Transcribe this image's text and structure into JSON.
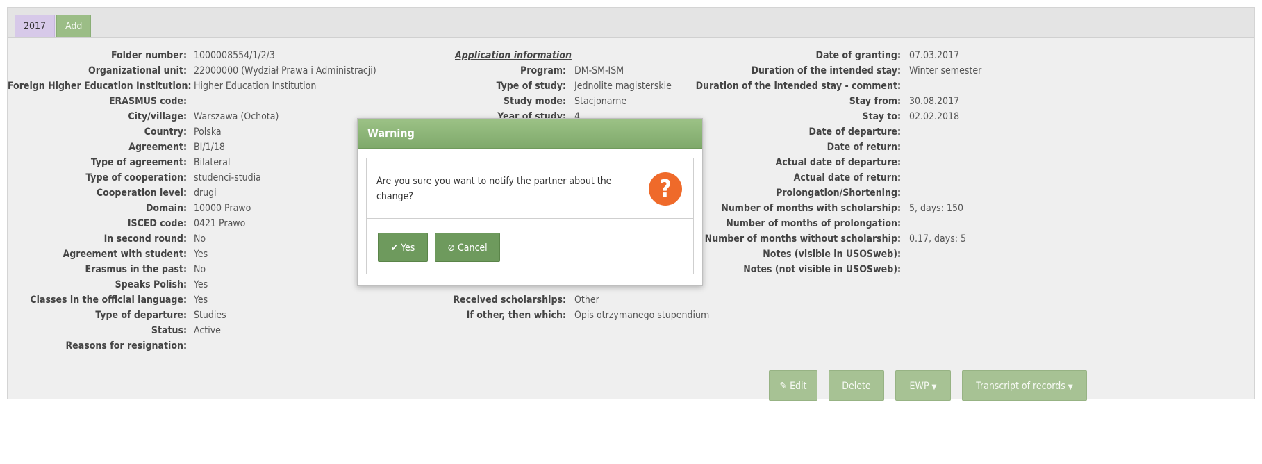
{
  "tabs": [
    {
      "label": "2017"
    },
    {
      "label": "Add"
    }
  ],
  "left_col": [
    {
      "label": "Folder number:",
      "value": "1000008554/1/2/3"
    },
    {
      "label": "Organizational unit:",
      "value": "22000000 (Wydział Prawa i Administracji)"
    },
    {
      "label": "Foreign Higher Education Institution:",
      "value": "Higher Education Institution"
    },
    {
      "label": "ERASMUS code:",
      "value": ""
    },
    {
      "label": "City/village:",
      "value": "Warszawa (Ochota)"
    },
    {
      "label": "Country:",
      "value": "Polska"
    },
    {
      "label": "Agreement:",
      "value": "BI/1/18"
    },
    {
      "label": "Type of agreement:",
      "value": "Bilateral"
    },
    {
      "label": "Type of cooperation:",
      "value": "studenci-studia"
    },
    {
      "label": "Cooperation level:",
      "value": "drugi"
    },
    {
      "label": "Domain:",
      "value": "10000 Prawo"
    },
    {
      "label": "ISCED code:",
      "value": "0421 Prawo"
    },
    {
      "label": "In second round:",
      "value": "No"
    },
    {
      "label": "Agreement with student:",
      "value": "Yes"
    },
    {
      "label": "Erasmus in the past:",
      "value": "No"
    },
    {
      "label": "Speaks Polish:",
      "value": "Yes"
    },
    {
      "label": "Classes in the official language:",
      "value": "Yes"
    },
    {
      "label": "Type of departure:",
      "value": "Studies"
    },
    {
      "label": "Status:",
      "value": "Active"
    },
    {
      "label": "Reasons for resignation:",
      "value": ""
    }
  ],
  "middle": {
    "section_title": "Application information",
    "rows": [
      {
        "label": "Program:",
        "value": "DM-SM-ISM"
      },
      {
        "label": "Type of study:",
        "value": "Jednolite magisterskie"
      },
      {
        "label": "Study mode:",
        "value": "Stacjonarne"
      },
      {
        "label": "Year of study:",
        "value": "4"
      },
      {
        "label": "Received scholarships:",
        "value": "Other"
      },
      {
        "label": "If other, then which:",
        "value": "Opis otrzymanego stupendium"
      }
    ]
  },
  "right_col": [
    {
      "label": "Date of granting:",
      "value": "07.03.2017"
    },
    {
      "label": "Duration of the intended stay:",
      "value": "Winter semester"
    },
    {
      "label": "Duration of the intended stay - comment:",
      "value": ""
    },
    {
      "label": "Stay from:",
      "value": "30.08.2017"
    },
    {
      "label": "Stay to:",
      "value": "02.02.2018"
    },
    {
      "label": "Date of departure:",
      "value": ""
    },
    {
      "label": "Date of return:",
      "value": ""
    },
    {
      "label": "Actual date of departure:",
      "value": ""
    },
    {
      "label": "Actual date of return:",
      "value": ""
    },
    {
      "label": "Prolongation/Shortening:",
      "value": ""
    },
    {
      "label": "Number of months with scholarship:",
      "value": "5, days: 150"
    },
    {
      "label": "Number of months of prolongation:",
      "value": ""
    },
    {
      "label": "Number of months without scholarship:",
      "value": "0.17, days: 5"
    },
    {
      "label": "Notes (visible in USOSweb):",
      "value": ""
    },
    {
      "label": "Notes (not visible in USOSweb):",
      "value": ""
    }
  ],
  "actions": {
    "edit": "Edit",
    "delete": "Delete",
    "ewp": "EWP",
    "transcript": "Transcript of records"
  },
  "dialog": {
    "title": "Warning",
    "message": "Are you sure you want to notify the partner about the change?",
    "yes": "Yes",
    "cancel": "Cancel"
  },
  "icons": {
    "question": "question-icon",
    "check": "check-icon",
    "cancel": "ban-icon",
    "edit": "pencil-icon",
    "caret": "caret-down-icon"
  },
  "colors": {
    "accent_green": "#7fa96b",
    "tab_purple": "#d7c9e9",
    "question_orange": "#ef6a2a"
  }
}
